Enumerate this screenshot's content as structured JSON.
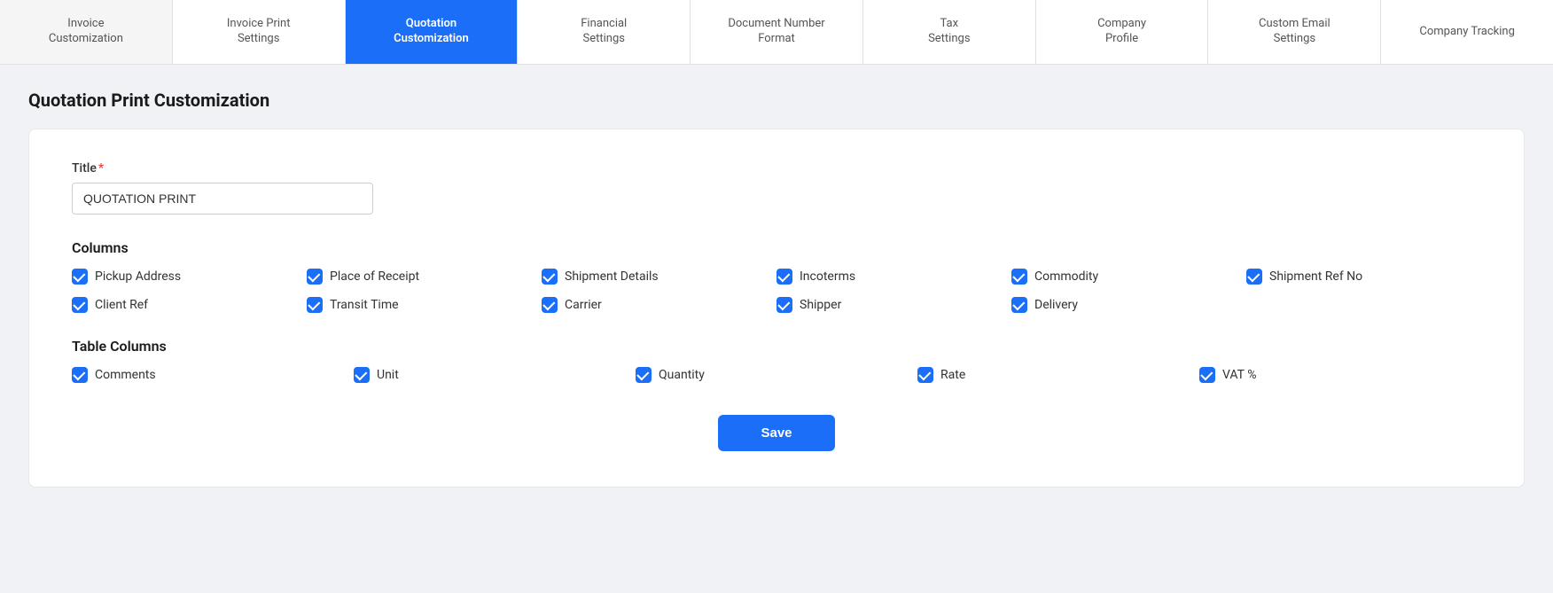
{
  "tabs": [
    {
      "id": "invoice-customization",
      "label": "Invoice\nCustomization",
      "active": false
    },
    {
      "id": "invoice-print-settings",
      "label": "Invoice Print\nSettings",
      "active": false
    },
    {
      "id": "quotation-customization",
      "label": "Quotation\nCustomization",
      "active": true
    },
    {
      "id": "financial-settings",
      "label": "Financial\nSettings",
      "active": false
    },
    {
      "id": "document-number-format",
      "label": "Document Number\nFormat",
      "active": false
    },
    {
      "id": "tax-settings",
      "label": "Tax\nSettings",
      "active": false
    },
    {
      "id": "company-profile",
      "label": "Company\nProfile",
      "active": false
    },
    {
      "id": "custom-email-settings",
      "label": "Custom Email\nSettings",
      "active": false
    },
    {
      "id": "company-tracking",
      "label": "Company Tracking",
      "active": false
    }
  ],
  "page": {
    "title": "Quotation Print Customization",
    "title_field_label": "Title",
    "title_field_value": "QUOTATION PRINT",
    "columns_section": "Columns",
    "table_columns_section": "Table Columns",
    "save_button": "Save"
  },
  "columns": [
    {
      "id": "pickup-address",
      "label": "Pickup Address",
      "checked": true
    },
    {
      "id": "place-of-receipt",
      "label": "Place of Receipt",
      "checked": true
    },
    {
      "id": "shipment-details",
      "label": "Shipment Details",
      "checked": true
    },
    {
      "id": "incoterms",
      "label": "Incoterms",
      "checked": true
    },
    {
      "id": "commodity",
      "label": "Commodity",
      "checked": true
    },
    {
      "id": "shipment-ref-no",
      "label": "Shipment Ref No",
      "checked": true
    },
    {
      "id": "client-ref",
      "label": "Client Ref",
      "checked": true
    },
    {
      "id": "transit-time",
      "label": "Transit Time",
      "checked": true
    },
    {
      "id": "carrier",
      "label": "Carrier",
      "checked": true
    },
    {
      "id": "shipper",
      "label": "Shipper",
      "checked": true
    },
    {
      "id": "delivery",
      "label": "Delivery",
      "checked": true
    }
  ],
  "table_columns": [
    {
      "id": "comments",
      "label": "Comments",
      "checked": true
    },
    {
      "id": "unit",
      "label": "Unit",
      "checked": true
    },
    {
      "id": "quantity",
      "label": "Quantity",
      "checked": true
    },
    {
      "id": "rate",
      "label": "Rate",
      "checked": true
    },
    {
      "id": "vat-percent",
      "label": "VAT %",
      "checked": true
    }
  ]
}
